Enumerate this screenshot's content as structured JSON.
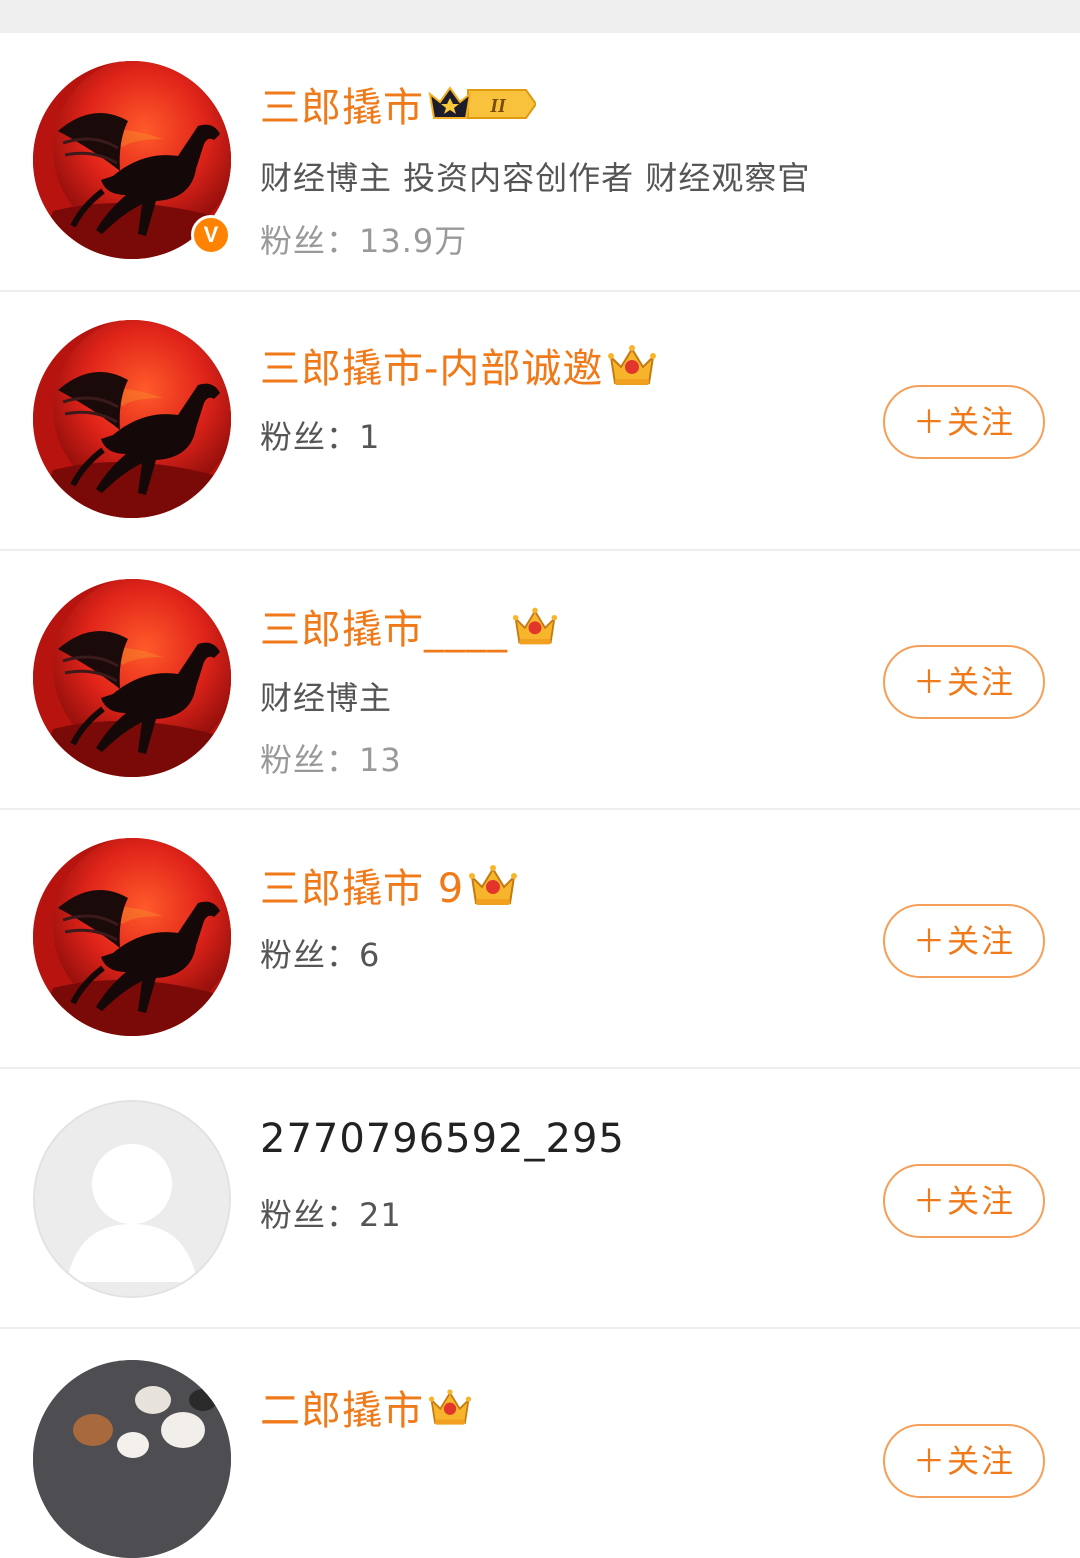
{
  "users": [
    {
      "name": "三郎撬市",
      "description": "财经博主  投资内容创作者 财经观察官",
      "fans_label": "粉丝：",
      "fans_count": "13.9万",
      "verified_badge": "V",
      "badge_icon": "crown-level-2-icon",
      "badge_text": "II",
      "avatar": "red-pegasus-avatar"
    },
    {
      "name": "三郎撬市-内部诚邀",
      "fans_label": "粉丝：",
      "fans_count": "1",
      "badge_icon": "gold-crown-icon",
      "follow_label": "＋关注",
      "avatar": "red-pegasus-avatar"
    },
    {
      "name": "三郎撬市____",
      "description": "财经博主",
      "fans_label": "粉丝：",
      "fans_count": "13",
      "badge_icon": "gold-crown-icon",
      "follow_label": "＋关注",
      "avatar": "red-pegasus-avatar"
    },
    {
      "name": "三郎撬市 9",
      "fans_label": "粉丝：",
      "fans_count": "6",
      "badge_icon": "gold-crown-icon",
      "follow_label": "＋关注",
      "avatar": "red-pegasus-avatar"
    },
    {
      "name": "2770796592_295",
      "fans_label": "粉丝：",
      "fans_count": "21",
      "follow_label": "＋关注",
      "avatar": "default-user-avatar"
    },
    {
      "name": "二郎撬市",
      "badge_icon": "gold-crown-icon",
      "follow_label": "＋关注",
      "avatar": "dogs-photo-avatar"
    }
  ],
  "colors": {
    "name_orange": "#f07a1a",
    "verified_orange": "#ff8200",
    "button_border": "#f4a05a",
    "avatar_red": "#c71a12"
  }
}
